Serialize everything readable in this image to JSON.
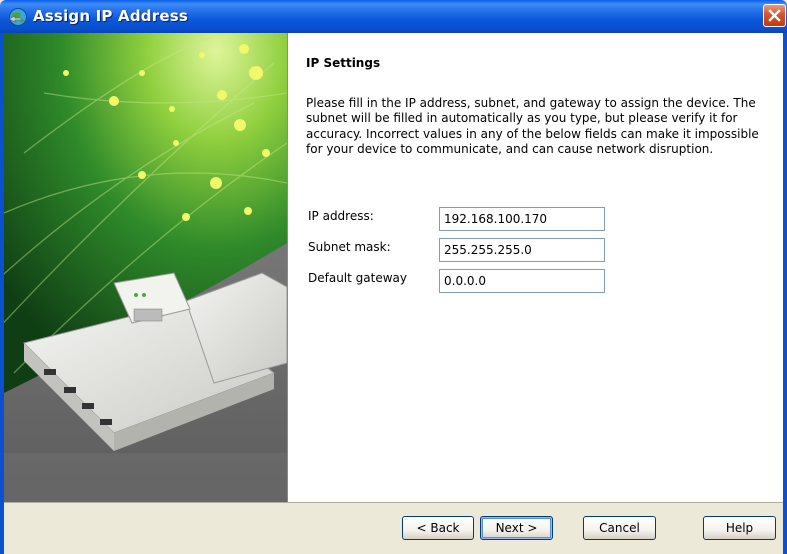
{
  "window": {
    "title": "Assign IP Address",
    "icon": "network-globe-icon",
    "close_icon": "close-icon"
  },
  "colors": {
    "titlebar": "#0A50CF",
    "dialog_background": "#ECE9D8",
    "close_button": "#D9542A",
    "input_border": "#7F9DB9"
  },
  "content": {
    "heading": "IP Settings",
    "description": "Please fill in the IP address, subnet, and gateway to assign the device. The subnet will be filled in automatically as you type, but please verify it for accuracy.  Incorrect values in any of the below fields can make it impossible for your device to communicate, and can cause network disruption."
  },
  "fields": {
    "ip_address": {
      "label": "IP address:",
      "value": "192.168.100.170"
    },
    "subnet_mask": {
      "label": "Subnet mask:",
      "value": "255.255.255.0"
    },
    "default_gateway": {
      "label": "Default gateway",
      "value": "0.0.0.0"
    }
  },
  "buttons": {
    "back": "< Back",
    "next": "Next >",
    "cancel": "Cancel",
    "help": "Help"
  }
}
